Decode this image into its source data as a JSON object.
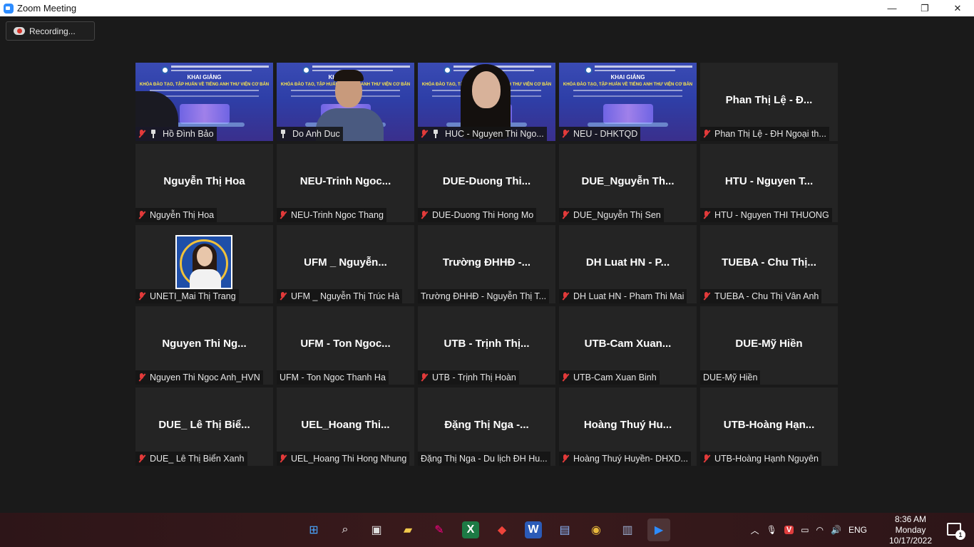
{
  "window": {
    "title": "Zoom Meeting",
    "minimize": "—",
    "restore": "❐",
    "close": "✕"
  },
  "recording": {
    "label": "Recording..."
  },
  "tiles": [
    {
      "label": "Hồ Đình Bảo",
      "type": "video",
      "muted": true,
      "pinned": true
    },
    {
      "label": "Do Anh Duc",
      "type": "video",
      "muted": false,
      "pinned": true,
      "active": true
    },
    {
      "label": "HUC - Nguyen Thi Ngo...",
      "type": "video",
      "muted": true,
      "pinned": true
    },
    {
      "label": "NEU - DHKTQD",
      "type": "video",
      "muted": true,
      "pinned": false
    },
    {
      "big": "Phan Thị Lệ - Đ...",
      "label": "Phan Thị Lệ - ĐH Ngoại th...",
      "muted": true
    },
    {
      "big": "Nguyễn Thị Hoa",
      "label": "Nguyễn Thị Hoa",
      "muted": true
    },
    {
      "big": "NEU-Trinh  Ngoc...",
      "label": "NEU-Trinh Ngoc Thang",
      "muted": true
    },
    {
      "big": "DUE-Duong  Thi...",
      "label": "DUE-Duong Thi Hong Mo",
      "muted": true
    },
    {
      "big": "DUE_Nguyễn  Th...",
      "label": "DUE_Nguyễn Thị Sen",
      "muted": true
    },
    {
      "big": "HTU  -  Nguyen  T...",
      "label": "HTU - Nguyen THI THUONG",
      "muted": true
    },
    {
      "label": "UNETI_Mai Thị Trang",
      "type": "avatar",
      "muted": true
    },
    {
      "big": "UFM  _  Nguyễn...",
      "label": "UFM _ Nguyễn Thị Trúc Hà",
      "muted": true
    },
    {
      "big": "Trường ĐHHĐ  -...",
      "label": "Trường ĐHHĐ - Nguyễn Thị T...",
      "muted": false
    },
    {
      "big": "DH Luat HN  -  P...",
      "label": "DH Luat HN - Pham Thi Mai",
      "muted": true
    },
    {
      "big": "TUEBA  -  Chu Thị...",
      "label": "TUEBA - Chu Thị Vân Anh",
      "muted": true
    },
    {
      "big": "Nguyen  Thi  Ng...",
      "label": "Nguyen Thi Ngoc Anh_HVN",
      "muted": true
    },
    {
      "big": "UFM  -  Ton  Ngoc...",
      "label": "UFM - Ton Ngoc Thanh Ha",
      "muted": false
    },
    {
      "big": "UTB  -  Trịnh  Thị...",
      "label": "UTB - Trịnh Thị Hoàn",
      "muted": true
    },
    {
      "big": "UTB-Cam  Xuan...",
      "label": "UTB-Cam Xuan Binh",
      "muted": true
    },
    {
      "big": "DUE-Mỹ Hiền",
      "label": "DUE-Mỹ Hiền",
      "muted": false
    },
    {
      "big": "DUE_  Lê  Thị  Biể...",
      "label": "DUE_ Lê Thị Biển Xanh",
      "muted": true
    },
    {
      "big": "UEL_Hoang  Thi...",
      "label": "UEL_Hoang Thi Hong Nhung",
      "muted": true
    },
    {
      "big": "Đặng  Thị  Nga  -...",
      "label": "Đặng Thị Nga - Du lịch ĐH Hu...",
      "muted": false
    },
    {
      "big": "Hoàng  Thuý  Hu...",
      "label": "Hoàng Thuý Huyền- DHXD...",
      "muted": true
    },
    {
      "big": "UTB-Hoàng  Hạn...",
      "label": "UTB-Hoàng Hạnh Nguyên",
      "muted": true
    }
  ],
  "banner": {
    "heading": "KHAI GIẢNG",
    "subheading": "KHÓA ĐÀO TẠO, TẬP HUẤN VỀ TIẾNG ANH THƯ VIỆN CƠ BẢN"
  },
  "taskbar": {
    "icons": [
      "windows-start",
      "search",
      "task-view",
      "file-explorer",
      "paint",
      "excel",
      "anydesk",
      "word",
      "remote-desktop",
      "chrome",
      "network-tool",
      "zoom"
    ],
    "tray": {
      "language": "ENG",
      "time": "8:36 AM",
      "day": "Monday",
      "date": "10/17/2022",
      "notifications": "1"
    }
  }
}
